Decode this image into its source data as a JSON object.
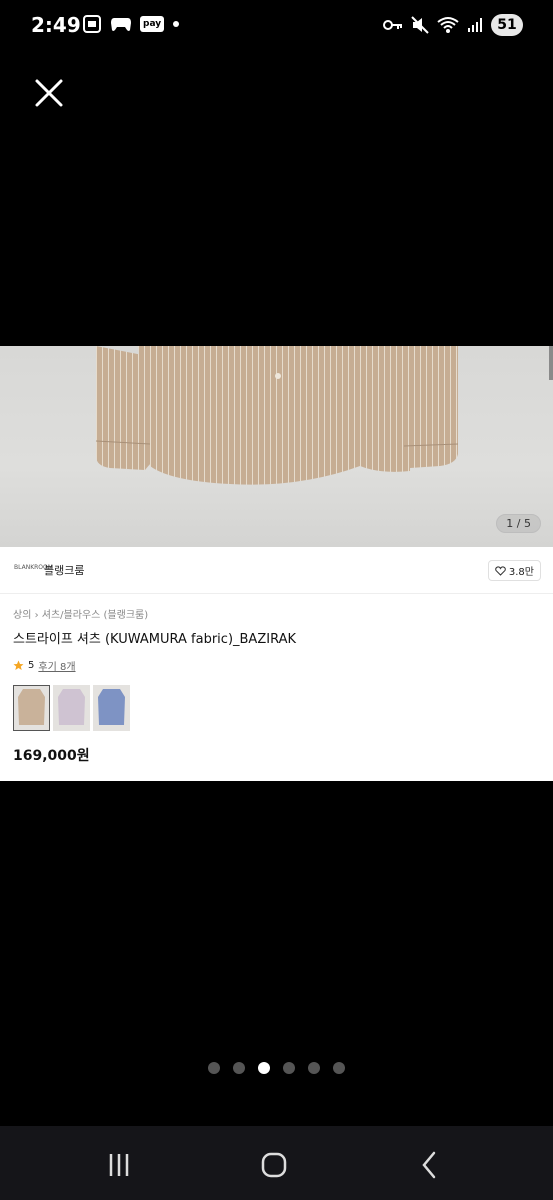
{
  "status": {
    "time": "2:49",
    "pay_label": "pay",
    "battery": "51"
  },
  "product": {
    "image_counter": "1 / 5",
    "shop_logo_text": "BLANKROOM",
    "shop_name": "블랭크룸",
    "likes": "3.8만",
    "breadcrumb": [
      "상의",
      "셔츠/블라우스 (블랭크룸)"
    ],
    "title": "스트라이프 셔츠 (KUWAMURA fabric)_BAZIRAK",
    "rating": "5",
    "reviews": "후기 8개",
    "color_options": [
      {
        "name": "beige-stripe",
        "color": "#c9b29a",
        "selected": true
      },
      {
        "name": "lavender-stripe",
        "color": "#cfc3d2",
        "selected": false
      },
      {
        "name": "blue-stripe",
        "color": "#7e93c4",
        "selected": false
      }
    ],
    "price": "169,000원"
  },
  "pager": {
    "count": 6,
    "active_index": 2
  },
  "colors": {
    "background": "#000000",
    "card": "#ffffff",
    "star": "#f5a623",
    "nav_bar": "#151519"
  }
}
